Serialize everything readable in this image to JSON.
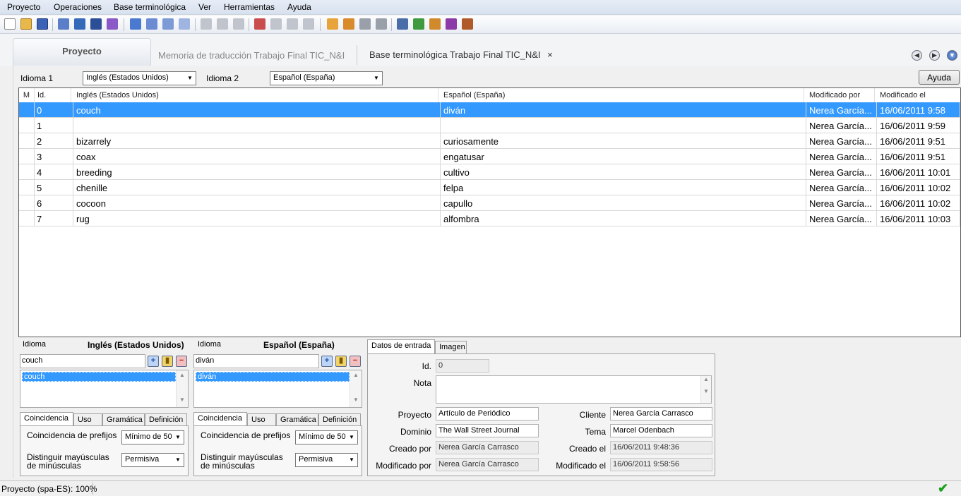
{
  "menubar": {
    "items": [
      "Proyecto",
      "Operaciones",
      "Base terminológica",
      "Ver",
      "Herramientas",
      "Ayuda"
    ]
  },
  "tabs": {
    "proyecto": "Proyecto",
    "memoria": "Memoria de traducción Trabajo Final TIC_N&I",
    "base": "Base terminológica Trabajo Final TIC_N&I",
    "close_glyph": "×"
  },
  "languages": {
    "idioma1_label": "Idioma 1",
    "idioma1_value": "Inglés (Estados Unidos)",
    "idioma2_label": "Idioma 2",
    "idioma2_value": "Español (España)",
    "help_button": "Ayuda"
  },
  "grid": {
    "headers": [
      "M",
      "Id.",
      "Inglés (Estados Unidos)",
      "Español (España)",
      "Modificado por",
      "Modificado el"
    ],
    "rows": [
      {
        "id": "0",
        "en": "couch",
        "es": "diván",
        "by": "Nerea García...",
        "date": "16/06/2011 9:58",
        "selected": true
      },
      {
        "id": "1",
        "en": "",
        "es": "",
        "by": "Nerea García...",
        "date": "16/06/2011 9:59",
        "selected": false
      },
      {
        "id": "2",
        "en": "bizarrely",
        "es": "curiosamente",
        "by": "Nerea García...",
        "date": "16/06/2011 9:51",
        "selected": false
      },
      {
        "id": "3",
        "en": "coax",
        "es": "engatusar",
        "by": "Nerea García...",
        "date": "16/06/2011 9:51",
        "selected": false
      },
      {
        "id": "4",
        "en": "breeding",
        "es": "cultivo",
        "by": "Nerea García...",
        "date": "16/06/2011 10:01",
        "selected": false
      },
      {
        "id": "5",
        "en": "chenille",
        "es": "felpa",
        "by": "Nerea García...",
        "date": "16/06/2011 10:02",
        "selected": false
      },
      {
        "id": "6",
        "en": "cocoon",
        "es": "capullo",
        "by": "Nerea García...",
        "date": "16/06/2011 10:02",
        "selected": false
      },
      {
        "id": "7",
        "en": "rug",
        "es": "alfombra",
        "by": "Nerea García...",
        "date": "16/06/2011 10:03",
        "selected": false
      }
    ]
  },
  "left_panel": {
    "idioma_label": "Idioma",
    "language": "Inglés (Estados Unidos)",
    "term_input": "couch",
    "list_item": "couch",
    "tabs": [
      "Coincidencia",
      "Uso",
      "Gramática",
      "Definición"
    ],
    "prefix_label": "Coincidencia de prefijos",
    "prefix_value": "Mínimo de 50",
    "case_label": "Distinguir mayúsculas de minúsculas",
    "case_value": "Permisiva"
  },
  "mid_panel": {
    "idioma_label": "Idioma",
    "language": "Español (España)",
    "term_input": "diván",
    "list_item": "diván",
    "tabs": [
      "Coincidencia",
      "Uso",
      "Gramática",
      "Definición"
    ],
    "prefix_label": "Coincidencia de prefijos",
    "prefix_value": "Mínimo de 50",
    "case_label": "Distinguir mayúsculas de minúsculas",
    "case_value": "Permisiva"
  },
  "entry_panel": {
    "tabs": [
      "Datos de entrada",
      "Imagen"
    ],
    "id_label": "Id.",
    "id_value": "0",
    "nota_label": "Nota",
    "proyecto_label": "Proyecto",
    "proyecto_value": "Artículo de Periódico",
    "cliente_label": "Cliente",
    "cliente_value": "Nerea García Carrasco",
    "dominio_label": "Dominio",
    "dominio_value": "The Wall Street Journal",
    "tema_label": "Tema",
    "tema_value": "Marcel Odenbach",
    "creado_por_label": "Creado por",
    "creado_por_value": "Nerea García Carrasco",
    "creado_el_label": "Creado el",
    "creado_el_value": "16/06/2011 9:48:36",
    "modificado_por_label": "Modificado por",
    "modificado_por_value": "Nerea García Carrasco",
    "modificado_el_label": "Modificado el",
    "modificado_el_value": "16/06/2011 9:58:56"
  },
  "status": {
    "text": "Proyecto (spa-ES): 100%"
  },
  "colors": {
    "selection": "#3399ff",
    "ok_check": "#1aa01a"
  }
}
